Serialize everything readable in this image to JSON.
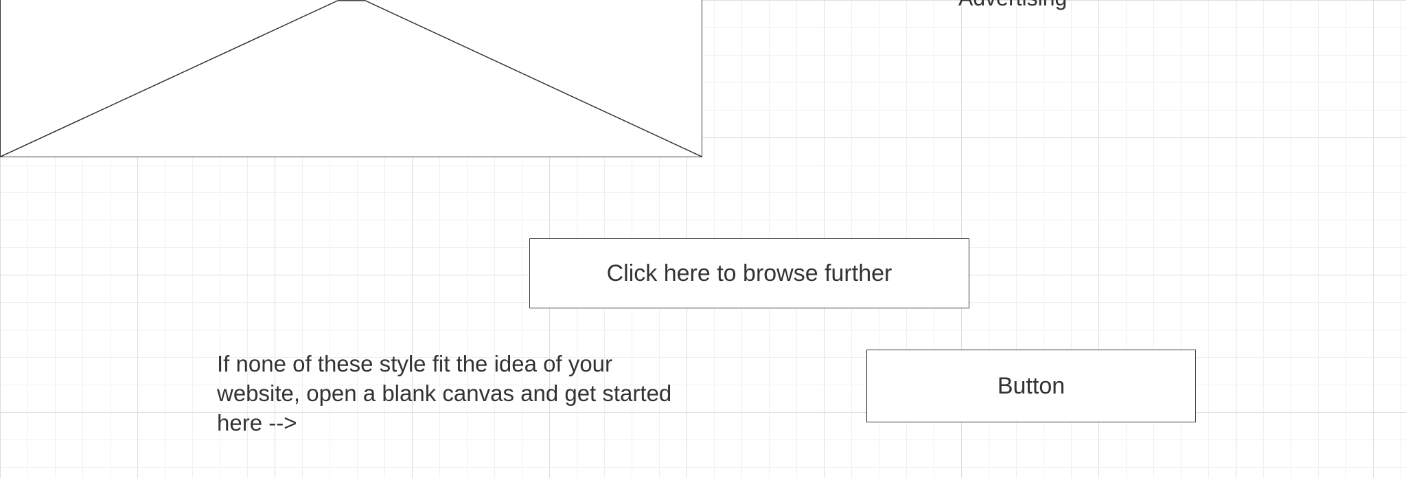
{
  "header": {
    "advertising_label": "Advertising"
  },
  "main": {
    "browse_button_label": "Click here to browse further",
    "blank_canvas_text": "If none of these style fit the idea of your website, open a blank canvas and get started here -->",
    "button_label": "Button"
  },
  "colors": {
    "stroke": "#333333",
    "grid_major": "#dddddd",
    "grid_minor": "#f0f0f0",
    "background": "#ffffff"
  }
}
